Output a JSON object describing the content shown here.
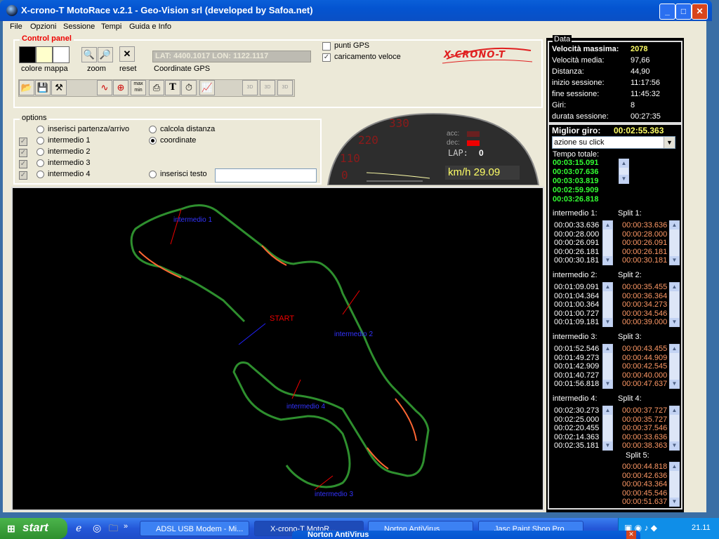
{
  "window": {
    "title": "X-crono-T MotoRace v.2.1 - Geo-Vision srl (developed by Safoa.net)"
  },
  "menu": [
    "File",
    "Opzioni",
    "Sessione",
    "Tempi",
    "Guida e Info"
  ],
  "control_panel": {
    "title": "Control panel",
    "colore_mappa": "colore mappa",
    "zoom": "zoom",
    "reset": "reset",
    "coords_value": "LAT: 4400.1017 LON: 1122.1117",
    "coords_label": "Coordinate GPS",
    "punti_gps": "punti GPS",
    "caricamento_veloce": "caricamento veloce",
    "logo": "X-CRONO-T",
    "tb_maxmin": "max min",
    "tb_3d": "3D"
  },
  "options": {
    "title": "options",
    "inserisci_partenza": "inserisci partenza/arrivo",
    "intermedio1": "intermedio 1",
    "intermedio2": "intermedio 2",
    "intermedio3": "intermedio 3",
    "intermedio4": "intermedio 4",
    "calcola_distanza": "calcola distanza",
    "coordinate": "coordinate",
    "inserisci_testo": "inserisci testo"
  },
  "gauge": {
    "tick330": "330",
    "tick220": "220",
    "tick110": "110",
    "tick0": "0",
    "acc": "acc:",
    "dec": "dec:",
    "lap_label": "LAP:",
    "lap_value": "0",
    "speed": "km/h 29.09"
  },
  "map": {
    "start": "START",
    "i1": "intermedio 1",
    "i2": "intermedio 2",
    "i3": "intermedio 3",
    "i4": "intermedio 4"
  },
  "data": {
    "title": "Data",
    "rows": [
      {
        "label": "Velocità massima:",
        "value": "2078"
      },
      {
        "label": "Velocità media:",
        "value": "97,66"
      },
      {
        "label": "Distanza:",
        "value": "44,90"
      },
      {
        "label": "inizio sessione:",
        "value": "11:17:56"
      },
      {
        "label": "fine sessione:",
        "value": "11:45:32"
      },
      {
        "label": "Giri:",
        "value": "8"
      },
      {
        "label": "durata sessione:",
        "value": "00:27:35"
      }
    ],
    "miglior_giro_label": "Miglior giro:",
    "miglior_giro_value": "00:02:55.363",
    "azione_select": "azione su click",
    "tempo_totale_label": "Tempo totale:",
    "tempo_totale": [
      "00:03:15.091",
      "00:03:07.636",
      "00:03:03.819",
      "00:02:59.909",
      "00:03:26.818"
    ],
    "intermedio1_label": "intermedio 1:",
    "intermedio1": [
      "00:00:33.636",
      "00:00:28.000",
      "00:00:26.091",
      "00:00:26.181",
      "00:00:30.181"
    ],
    "split1_label": "Split 1:",
    "split1": [
      "00:00:33.636",
      "00:00:28.000",
      "00:00:26.091",
      "00:00:26.181",
      "00:00:30.181"
    ],
    "intermedio2_label": "intermedio 2:",
    "intermedio2": [
      "00:01:09.091",
      "00:01:04.364",
      "00:01:00.364",
      "00:01:00.727",
      "00:01:09.181"
    ],
    "split2_label": "Split 2:",
    "split2": [
      "00:00:35.455",
      "00:00:36.364",
      "00:00:34.273",
      "00:00:34.546",
      "00:00:39.000"
    ],
    "intermedio3_label": "intermedio 3:",
    "intermedio3": [
      "00:01:52.546",
      "00:01:49.273",
      "00:01:42.909",
      "00:01:40.727",
      "00:01:56.818"
    ],
    "split3_label": "Split 3:",
    "split3": [
      "00:00:43.455",
      "00:00:44.909",
      "00:00:42.545",
      "00:00:40.000",
      "00:00:47.637"
    ],
    "intermedio4_label": "intermedio 4:",
    "intermedio4": [
      "00:02:30.273",
      "00:02:25.000",
      "00:02:20.455",
      "00:02:14.363",
      "00:02:35.181"
    ],
    "split4_label": "Split 4:",
    "split4": [
      "00:00:37.727",
      "00:00:35.727",
      "00:00:37.546",
      "00:00:33.636",
      "00:00:38.363"
    ],
    "split5_label": "Split 5:",
    "split5": [
      "00:00:44.818",
      "00:00:42.636",
      "00:00:43.364",
      "00:00:45.546",
      "00:00:51.637"
    ]
  },
  "taskbar": {
    "start": "start",
    "tasks": [
      "ADSL USB Modem - Mi...",
      "X-crono-T MotoR...",
      "Norton AntiVirus",
      "Jasc Paint Shop Pro"
    ],
    "clock": "21.11",
    "popup": "Norton AntiVirus"
  },
  "colors": {
    "green_time": "#33ff33",
    "orange_split": "#ff9966",
    "yellow_value": "#ffff66",
    "logo_red": "#e02020"
  }
}
